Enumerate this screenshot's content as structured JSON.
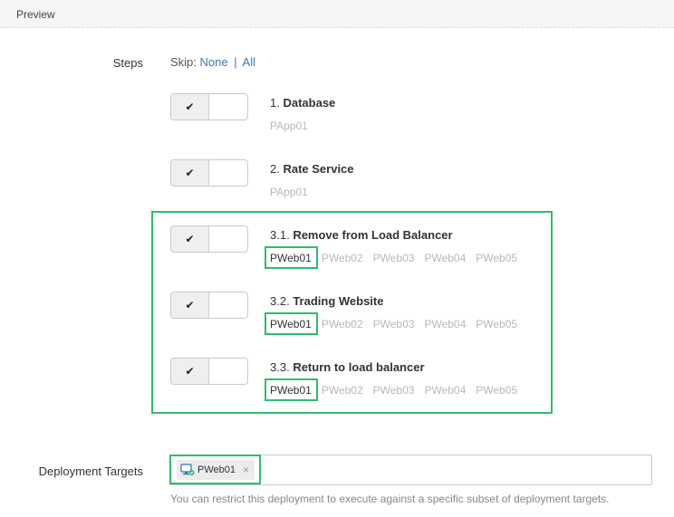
{
  "header": {
    "title": "Preview"
  },
  "steps_label": "Steps",
  "skip": {
    "prefix": "Skip:",
    "none_label": "None",
    "separator": "|",
    "all_label": "All"
  },
  "toggle_icon": "check-icon",
  "steps": [
    {
      "number": "1.",
      "name": "Database",
      "machines": [
        "PApp01"
      ],
      "enabled": true
    },
    {
      "number": "2.",
      "name": "Rate Service",
      "machines": [
        "PApp01"
      ],
      "enabled": true
    },
    {
      "number": "3.1.",
      "name": "Remove from Load Balancer",
      "machines": [
        "PWeb01",
        "PWeb02",
        "PWeb03",
        "PWeb04",
        "PWeb05"
      ],
      "enabled": true
    },
    {
      "number": "3.2.",
      "name": "Trading Website",
      "machines": [
        "PWeb01",
        "PWeb02",
        "PWeb03",
        "PWeb04",
        "PWeb05"
      ],
      "enabled": true
    },
    {
      "number": "3.3.",
      "name": "Return to load balancer",
      "machines": [
        "PWeb01",
        "PWeb02",
        "PWeb03",
        "PWeb04",
        "PWeb05"
      ],
      "enabled": true
    }
  ],
  "deployment_targets": {
    "label": "Deployment Targets",
    "selected": [
      {
        "name": "PWeb01",
        "icon": "machine-healthy-icon"
      }
    ],
    "remove_symbol": "×",
    "help": "You can restrict this deployment to execute against a specific subset of deployment targets."
  },
  "colors": {
    "highlight": "#2ebd6b",
    "link": "#3a78b5",
    "muted_machine": "#b8b8b8"
  }
}
